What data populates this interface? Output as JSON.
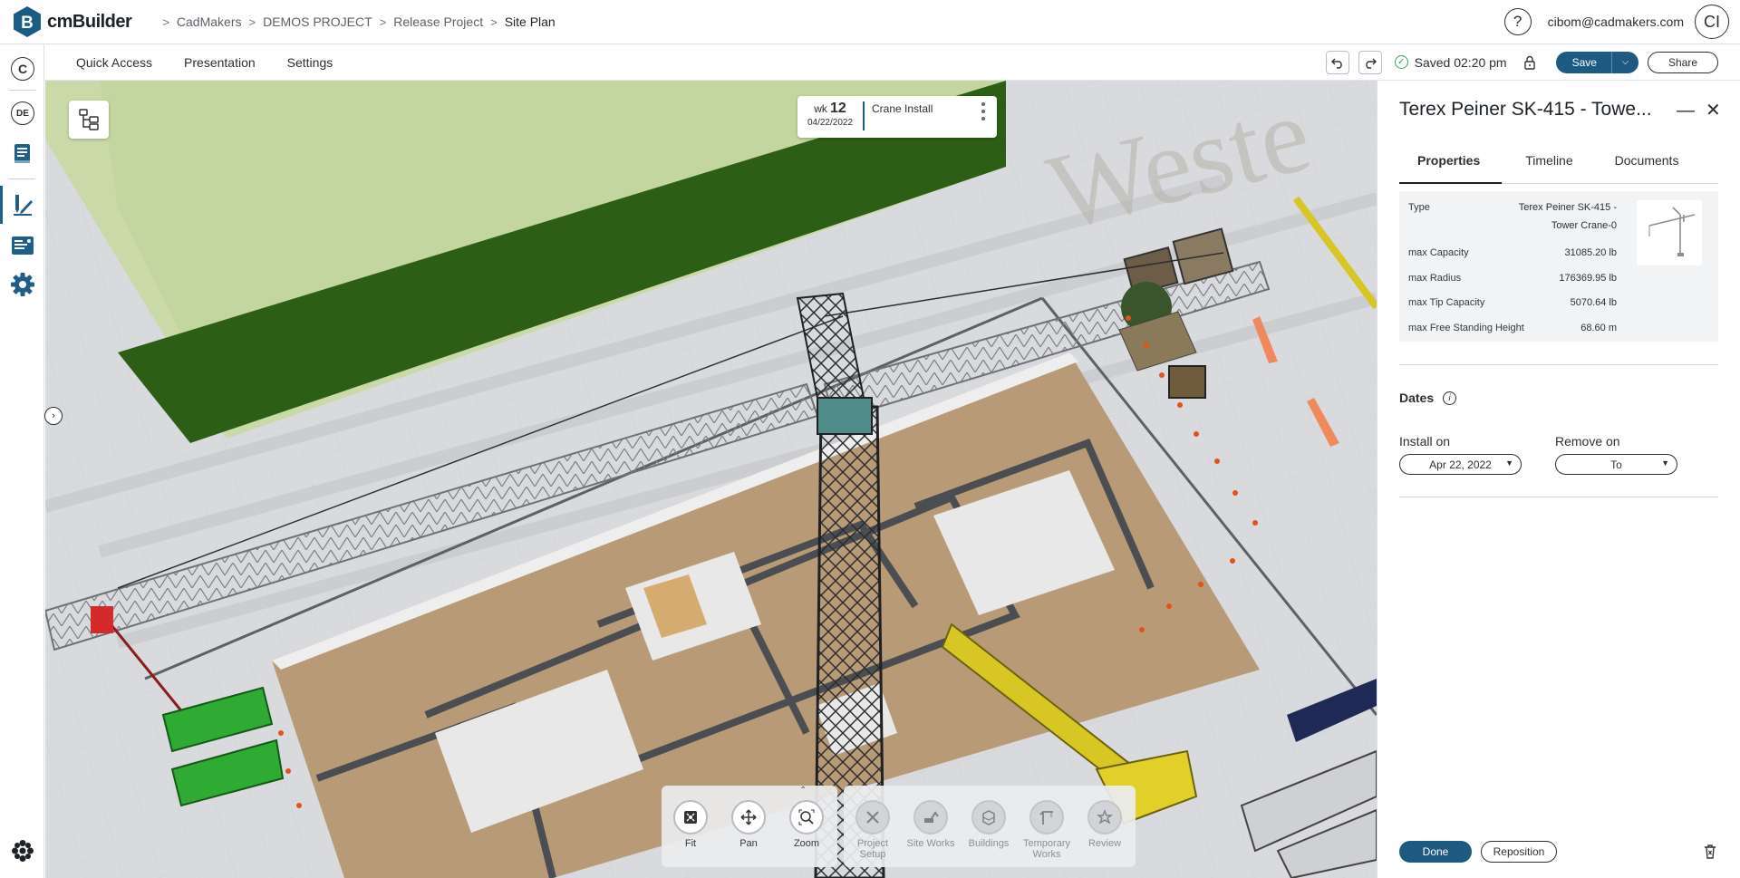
{
  "app": {
    "name": "cmBuilder"
  },
  "breadcrumbs": [
    "CadMakers",
    "DEMOS PROJECT",
    "Release Project",
    "Site Plan"
  ],
  "header": {
    "help_label": "?",
    "user_email": "cibom@cadmakers.com",
    "avatar_initials": "CI"
  },
  "rail": {
    "company_initial": "C",
    "user_initials": "DE"
  },
  "menu": {
    "items": [
      "Quick Access",
      "Presentation",
      "Settings"
    ]
  },
  "status": {
    "saved_text": "Saved 02:20 pm",
    "save_label": "Save",
    "share_label": "Share"
  },
  "week_card": {
    "wk_label": "wk",
    "wk_number": "12",
    "date": "04/22/2022",
    "activity": "Crane Install"
  },
  "toolbar": {
    "view_tools": [
      {
        "label": "Fit",
        "icon": "fit-icon"
      },
      {
        "label": "Pan",
        "icon": "pan-icon"
      },
      {
        "label": "Zoom",
        "icon": "zoom-icon"
      }
    ],
    "build_tools": [
      {
        "label": "Project Setup",
        "icon": "tools-icon"
      },
      {
        "label": "Site Works",
        "icon": "excavator-icon"
      },
      {
        "label": "Buildings",
        "icon": "buildings-icon"
      },
      {
        "label": "Temporary Works",
        "icon": "crane-icon"
      },
      {
        "label": "Review",
        "icon": "review-icon"
      }
    ]
  },
  "panel": {
    "title": "Terex Peiner SK-415 - Towe...",
    "tabs": [
      "Properties",
      "Timeline",
      "Documents"
    ],
    "active_tab": "Properties",
    "properties": [
      {
        "key": "Type",
        "value": "Terex Peiner SK-415 - Tower Crane-0"
      },
      {
        "key": "max Capacity",
        "value": "31085.20 lb"
      },
      {
        "key": "max Radius",
        "value": "176369.95 lb"
      },
      {
        "key": "max Tip Capacity",
        "value": "5070.64 lb"
      },
      {
        "key": "max Free Standing Height",
        "value": "68.60 m"
      }
    ],
    "dates_title": "Dates",
    "install_label": "Install on",
    "install_value": "Apr 22, 2022",
    "remove_label": "Remove on",
    "remove_value": "To",
    "done_label": "Done",
    "reposition_label": "Reposition"
  },
  "scene_text": {
    "ground_lettering": "Weste"
  },
  "colors": {
    "brand": "#1d5a82",
    "accent_blue": "#1c6089",
    "saved_green": "#3aa35a",
    "roof_green": "#2e5f16",
    "foundation_tan": "#b99b78"
  }
}
